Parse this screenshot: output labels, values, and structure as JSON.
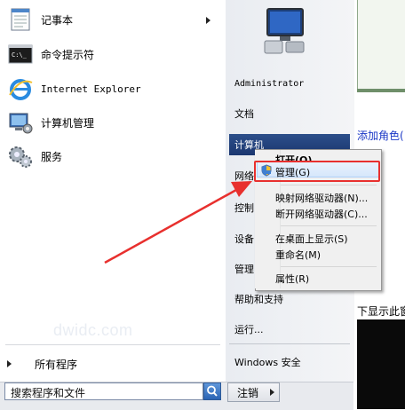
{
  "background_window": {
    "blue_text": "添加角色(",
    "gray_text": "下显示此窗"
  },
  "start_menu": {
    "programs": [
      {
        "label": "记事本",
        "icon": "notepad-icon",
        "has_submenu": true
      },
      {
        "label": "命令提示符",
        "icon": "cmd-icon",
        "has_submenu": false
      },
      {
        "label": "Internet Explorer",
        "icon": "ie-icon",
        "has_submenu": false
      },
      {
        "label": "计算机管理",
        "icon": "computer-management-icon",
        "has_submenu": false
      },
      {
        "label": "服务",
        "icon": "services-icon",
        "has_submenu": false
      }
    ],
    "all_programs": "所有程序",
    "search_placeholder": "搜索程序和文件",
    "right_items": {
      "user": "Administrator",
      "documents": "文档",
      "computer": "计算机",
      "network": "网络",
      "control": "控制",
      "devices": "设备",
      "manage": "管理",
      "help": "帮助和支持",
      "run": "运行...",
      "security": "Windows 安全"
    },
    "shutdown_label": "注销"
  },
  "context_menu": {
    "open": "打开(O)",
    "manage": "管理(G)",
    "map_drive": "映射网络驱动器(N)...",
    "disconnect_drive": "断开网络驱动器(C)...",
    "show_desktop": "在桌面上显示(S)",
    "rename": "重命名(M)",
    "properties": "属性(R)"
  },
  "watermark": "dwidc.com",
  "colors": {
    "highlight": "#1b3770",
    "annotation_red": "#e8302e",
    "link_blue": "#1a37c6"
  }
}
